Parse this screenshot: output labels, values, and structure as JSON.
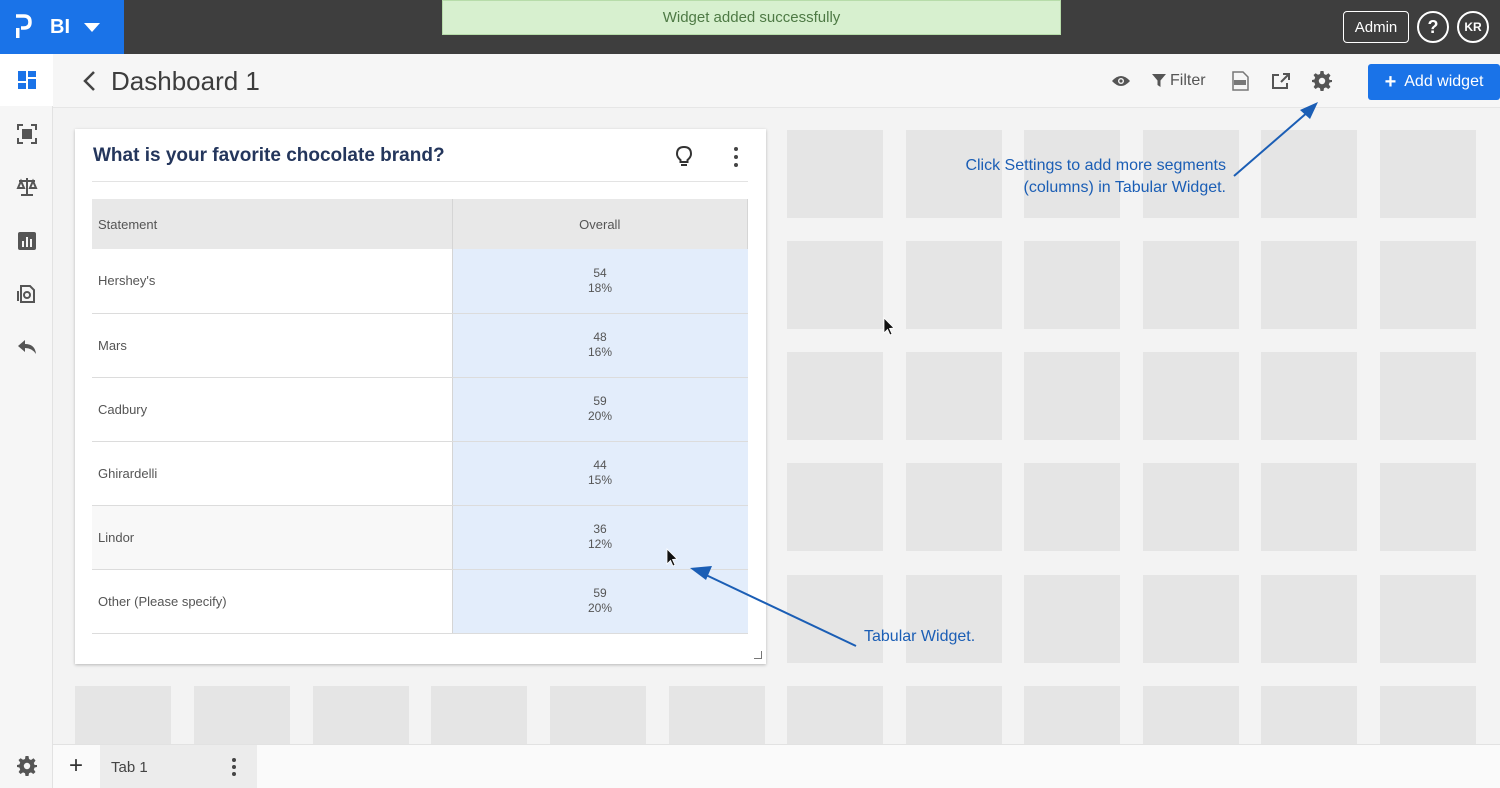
{
  "app": {
    "brand_name": "BI",
    "toast": "Widget added successfully",
    "admin_label": "Admin",
    "help_label": "?",
    "user_initials": "KR"
  },
  "header": {
    "title": "Dashboard 1",
    "filter_label": "Filter",
    "add_widget_label": "Add widget"
  },
  "sidebar": {
    "items": [
      {
        "icon": "dashboard-icon"
      },
      {
        "icon": "scan-icon"
      },
      {
        "icon": "balance-scale-icon"
      },
      {
        "icon": "bar-chart-icon"
      },
      {
        "icon": "report-icon"
      },
      {
        "icon": "reply-icon"
      }
    ]
  },
  "widget": {
    "title": "What is your favorite chocolate brand?",
    "columns": [
      "Statement",
      "Overall"
    ],
    "rows": [
      {
        "statement": "Hershey's",
        "count": "54",
        "percent": "18%"
      },
      {
        "statement": "Mars",
        "count": "48",
        "percent": "16%"
      },
      {
        "statement": "Cadbury",
        "count": "59",
        "percent": "20%"
      },
      {
        "statement": "Ghirardelli",
        "count": "44",
        "percent": "15%"
      },
      {
        "statement": "Lindor",
        "count": "36",
        "percent": "12%"
      },
      {
        "statement": "Other (Please specify)",
        "count": "59",
        "percent": "20%"
      }
    ]
  },
  "annotations": {
    "settings_line1": "Click Settings to add more segments",
    "settings_line2": "(columns) in Tabular Widget.",
    "table_note": "Tabular Widget."
  },
  "tabs": [
    {
      "label": "Tab 1"
    }
  ],
  "colors": {
    "accent": "#1a73e8",
    "topbar": "#3e3e3e",
    "annotation": "#1b5eb5",
    "toast_bg": "#d7f0cf"
  }
}
